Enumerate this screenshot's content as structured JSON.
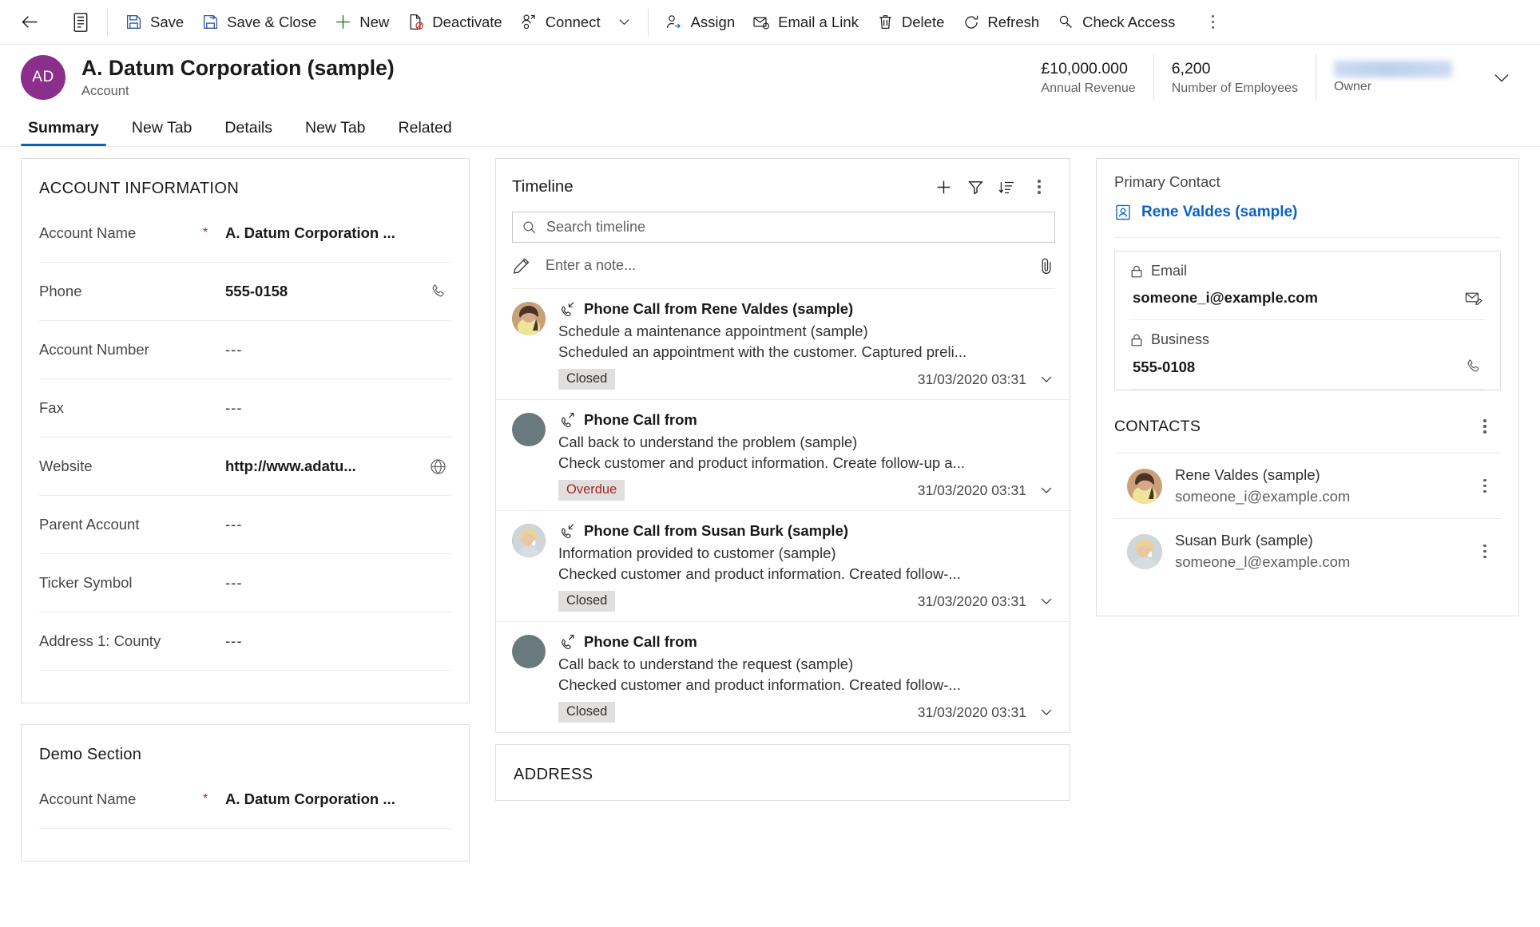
{
  "commandbar": {
    "back_label": "Back",
    "form_selector_label": "Form selector",
    "buttons": [
      {
        "id": "save",
        "label": "Save",
        "icon": "save-icon"
      },
      {
        "id": "save-close",
        "label": "Save & Close",
        "icon": "save-and-close-icon"
      },
      {
        "id": "new",
        "label": "New",
        "icon": "plus-icon"
      },
      {
        "id": "deactivate",
        "label": "Deactivate",
        "icon": "deactivate-icon"
      },
      {
        "id": "connect",
        "label": "Connect",
        "icon": "connect-icon"
      }
    ],
    "buttons2": [
      {
        "id": "assign",
        "label": "Assign",
        "icon": "assign-user-icon"
      },
      {
        "id": "email-a-link",
        "label": "Email a Link",
        "icon": "email-link-icon"
      },
      {
        "id": "delete",
        "label": "Delete",
        "icon": "trash-icon"
      },
      {
        "id": "refresh",
        "label": "Refresh",
        "icon": "refresh-icon"
      },
      {
        "id": "check-access",
        "label": "Check Access",
        "icon": "key-icon"
      }
    ],
    "overflow_label": "More commands"
  },
  "record_header": {
    "avatar_initials": "AD",
    "title": "A. Datum Corporation (sample)",
    "entity": "Account",
    "stats": [
      {
        "value": "£10,000.000",
        "label": "Annual Revenue"
      },
      {
        "value": "6,200",
        "label": "Number of Employees"
      },
      {
        "value": "",
        "label": "Owner",
        "redacted": true
      }
    ],
    "expand_label": "Expand header"
  },
  "tabs": [
    {
      "label": "Summary",
      "active": true
    },
    {
      "label": "New Tab",
      "active": false
    },
    {
      "label": "Details",
      "active": false
    },
    {
      "label": "New Tab",
      "active": false
    },
    {
      "label": "Related",
      "active": false
    }
  ],
  "account_information": {
    "section_title": "ACCOUNT INFORMATION",
    "fields": [
      {
        "label": "Account Name",
        "required": true,
        "value": "A. Datum Corporation ...",
        "icon": null
      },
      {
        "label": "Phone",
        "required": false,
        "value": "555-0158",
        "icon": "phone-icon"
      },
      {
        "label": "Account Number",
        "required": false,
        "value": "---",
        "icon": null
      },
      {
        "label": "Fax",
        "required": false,
        "value": "---",
        "icon": null
      },
      {
        "label": "Website",
        "required": false,
        "value": "http://www.adatu...",
        "icon": "globe-icon"
      },
      {
        "label": "Parent Account",
        "required": false,
        "value": "---",
        "icon": null
      },
      {
        "label": "Ticker Symbol",
        "required": false,
        "value": "---",
        "icon": null
      },
      {
        "label": "Address 1: County",
        "required": false,
        "value": "---",
        "icon": null
      }
    ]
  },
  "demo_section": {
    "section_title": "Demo Section",
    "fields": [
      {
        "label": "Account Name",
        "required": true,
        "value": "A. Datum Corporation ...",
        "icon": null
      }
    ]
  },
  "timeline": {
    "title": "Timeline",
    "actions": [
      {
        "id": "create-record",
        "label": "Create a timeline record",
        "icon": "plus-icon"
      },
      {
        "id": "filter",
        "label": "Filter timeline",
        "icon": "filter-icon"
      },
      {
        "id": "sort",
        "label": "Sort timeline",
        "icon": "sort-icon"
      },
      {
        "id": "more",
        "label": "More timeline commands",
        "icon": "more-vertical-icon"
      }
    ],
    "search_placeholder": "Search timeline",
    "note_placeholder": "Enter a note...",
    "note_attach_label": "Add attachment",
    "items": [
      {
        "direction": "incoming",
        "subject": "Phone Call from Rene Valdes (sample)",
        "line2": "Schedule a maintenance appointment (sample)",
        "line3": "Scheduled an appointment with the customer. Captured preli...",
        "status": "Closed",
        "status_kind": "closed",
        "timestamp": "31/03/2020 03:31",
        "avatar": "photo-woman-dark-hair"
      },
      {
        "direction": "outgoing",
        "subject": "Phone Call from",
        "line2": "Call back to understand the problem (sample)",
        "line3": "Check customer and product information. Create follow-up a...",
        "status": "Overdue",
        "status_kind": "overdue",
        "timestamp": "31/03/2020 03:31",
        "avatar": "placeholder"
      },
      {
        "direction": "incoming",
        "subject": "Phone Call from Susan Burk (sample)",
        "line2": "Information provided to customer (sample)",
        "line3": "Checked customer and product information. Created follow-...",
        "status": "Closed",
        "status_kind": "closed",
        "timestamp": "31/03/2020 03:31",
        "avatar": "photo-woman-blonde"
      },
      {
        "direction": "outgoing",
        "subject": "Phone Call from",
        "line2": "Call back to understand the request (sample)",
        "line3": "Checked customer and product information. Created follow-...",
        "status": "Closed",
        "status_kind": "closed",
        "timestamp": "31/03/2020 03:31",
        "avatar": "placeholder"
      }
    ]
  },
  "address_section": {
    "title": "ADDRESS"
  },
  "right_panel": {
    "primary_contact": {
      "label": "Primary Contact",
      "name": "Rene Valdes (sample)",
      "icon": "contact-card-icon"
    },
    "contact_fields": [
      {
        "label": "Email",
        "value": "someone_i@example.com",
        "lock": true,
        "icon": "email-icon"
      },
      {
        "label": "Business",
        "value": "555-0108",
        "lock": true,
        "icon": "phone-icon"
      }
    ],
    "contacts": {
      "title": "CONTACTS",
      "more_label": "More contacts commands",
      "items": [
        {
          "name": "Rene Valdes (sample)",
          "email": "someone_i@example.com",
          "avatar": "photo-woman-dark-hair",
          "more_label": "More commands"
        },
        {
          "name": "Susan Burk (sample)",
          "email": "someone_l@example.com",
          "avatar": "photo-woman-blonde",
          "more_label": "More commands"
        }
      ]
    }
  },
  "colors": {
    "accent": "#0b62c4",
    "avatar_purple": "#8c2f8c",
    "required_red": "#a4262c",
    "badge_bg": "#e1dfdd",
    "border": "#e1dfdd",
    "text_primary": "#1b1a19",
    "text_secondary": "#605e5c",
    "save_icon_blue": "#2b579a",
    "new_icon_green": "#2e8540"
  }
}
